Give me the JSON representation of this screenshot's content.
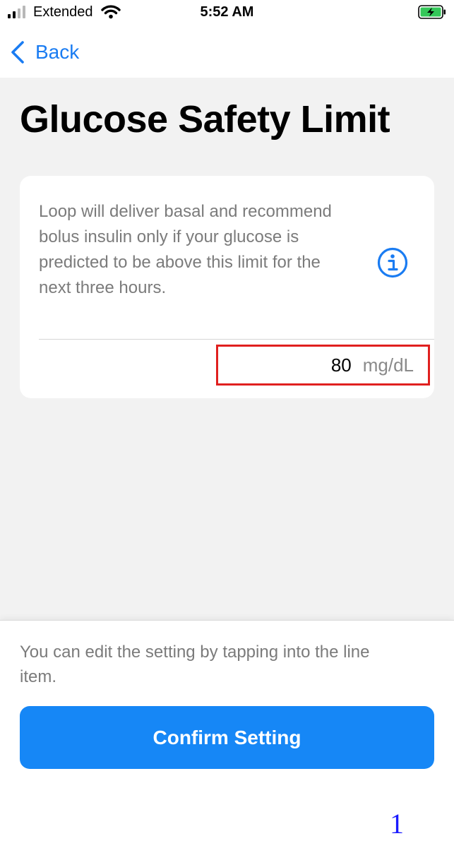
{
  "status_bar": {
    "carrier": "Extended",
    "time": "5:52 AM",
    "icons": [
      "signal-icon",
      "wifi-icon",
      "battery-charging-icon"
    ]
  },
  "nav": {
    "back_label": "Back",
    "back_icon": "chevron-left-icon"
  },
  "page": {
    "title": "Glucose Safety Limit"
  },
  "card": {
    "description": "Loop will deliver basal and recommend bolus insulin only if your glucose is predicted to be above this limit for the next three hours.",
    "info_icon": "info-icon",
    "value": "80",
    "unit": "mg/dL",
    "highlight_color": "#e0201f"
  },
  "footer": {
    "hint": "You can edit the setting by tapping into the line item.",
    "confirm_label": "Confirm Setting"
  },
  "step_marker": "1",
  "colors": {
    "accent": "#1687f6",
    "background": "#f2f2f2",
    "battery": "#34c759"
  }
}
